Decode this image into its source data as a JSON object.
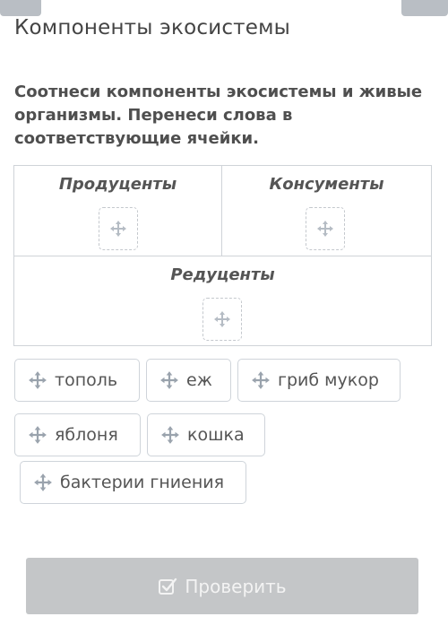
{
  "header": {
    "title": "Компоненты экосистемы"
  },
  "task": {
    "text": "Соотнеси компоненты экосистемы и живые организмы. Перенеси слова в соответствующие ячейки."
  },
  "targets": [
    {
      "label": "Продуценты"
    },
    {
      "label": "Консументы"
    },
    {
      "label": "Редуценты"
    }
  ],
  "chips": [
    {
      "label": "тополь"
    },
    {
      "label": "еж"
    },
    {
      "label": "гриб мукор"
    },
    {
      "label": "яблоня"
    },
    {
      "label": "кошка"
    },
    {
      "label": "бактерии гниения"
    }
  ],
  "check_button": {
    "label": "Проверить",
    "icon": "checkbox-check-icon"
  },
  "colors": {
    "chip_icon": "#9aa3ad",
    "border": "#cfd3d8",
    "button_bg": "#c4c6c8",
    "button_text": "#f3f3f3",
    "corner_buttons": "#b9bec4"
  },
  "icons": {
    "chip": "move-arrows-icon",
    "drop_zone": "move-arrows-icon"
  }
}
